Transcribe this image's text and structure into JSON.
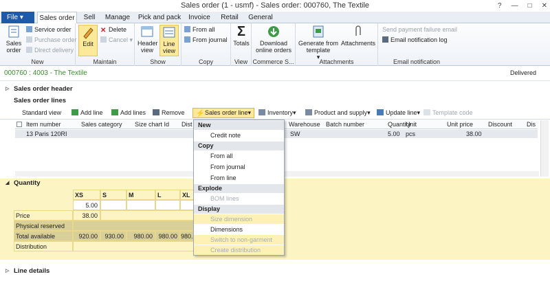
{
  "window": {
    "title": "Sales order (1 - usmf) - Sales order: 000760, The Textile"
  },
  "tabs": {
    "file": "File",
    "items": [
      "Sales order",
      "Sell",
      "Manage",
      "Pick and pack",
      "Invoice",
      "Retail",
      "General"
    ]
  },
  "ribbon": {
    "new": {
      "label": "New",
      "sales_order": "Sales\norder",
      "service_order": "Service order",
      "purchase_order": "Purchase order",
      "direct_delivery": "Direct delivery"
    },
    "maintain": {
      "label": "Maintain",
      "edit": "Edit",
      "delete": "Delete",
      "cancel": "Cancel"
    },
    "show": {
      "label": "Show",
      "header_view": "Header\nview",
      "line_view": "Line\nview"
    },
    "copy": {
      "label": "Copy",
      "from_all": "From all",
      "from_journal": "From journal"
    },
    "view": {
      "label": "View",
      "totals": "Totals"
    },
    "commerce": {
      "label": "Commerce S...",
      "download": "Download\nonline orders"
    },
    "attachments": {
      "label": "Attachments",
      "generate": "Generate from\ntemplate",
      "attachments": "Attachments"
    },
    "email": {
      "label": "Email notification",
      "send_failure": "Send payment failure email",
      "log": "Email notification log"
    }
  },
  "record": {
    "title": "000760 : 4003 - The Textile",
    "status": "Delivered"
  },
  "fasttabs": {
    "header": "Sales order header",
    "lines": "Sales order lines",
    "quantity": "Quantity",
    "line_details": "Line details"
  },
  "lines_toolbar": {
    "standard_view": "Standard view",
    "add_line": "Add line",
    "add_lines": "Add lines",
    "remove": "Remove",
    "sales_order_line": "Sales order line",
    "inventory": "Inventory",
    "product_supply": "Product and supply",
    "update_line": "Update line",
    "template_code": "Template code"
  },
  "grid": {
    "columns": [
      "Item number",
      "Sales category",
      "Size chart Id",
      "Dist",
      "Warehouse",
      "Batch number",
      "Quantity",
      "Unit",
      "Unit price",
      "Discount",
      "Dis"
    ],
    "rows": [
      {
        "item": "13 Paris 120RI",
        "warehouse": "SW",
        "quantity": "5.00",
        "unit": "pcs",
        "unit_price": "38.00"
      }
    ]
  },
  "quantity_matrix": {
    "sizes": [
      "XS",
      "S",
      "M",
      "L",
      "XL"
    ],
    "qty_value": "5.00",
    "rows": [
      {
        "label": "Price",
        "values": [
          "38.00",
          "",
          "",
          "",
          ""
        ]
      },
      {
        "label": "Physical reserved",
        "values": [
          "",
          "",
          "",
          "",
          ""
        ]
      },
      {
        "label": "Total available",
        "values": [
          "920.00",
          "930.00",
          "980.00",
          "980.00",
          "980."
        ]
      },
      {
        "label": "Distribution",
        "values": [
          "",
          "",
          "",
          "",
          ""
        ]
      }
    ]
  },
  "menu": {
    "new": "New",
    "credit_note": "Credit note",
    "copy": "Copy",
    "from_all": "From all",
    "from_journal": "From journal",
    "from_line": "From line",
    "explode": "Explode",
    "bom_lines": "BOM lines",
    "display": "Display",
    "size_dimension": "Size dimension",
    "dimensions": "Dimensions",
    "switch_non_garment": "Switch to non-garment",
    "create_distribution": "Create distribution"
  },
  "colors": {
    "accent": "#1e5aa8",
    "record_green": "#3a8a2e",
    "highlight": "#fde99a",
    "quantity_bg": "#fdf4c3"
  }
}
